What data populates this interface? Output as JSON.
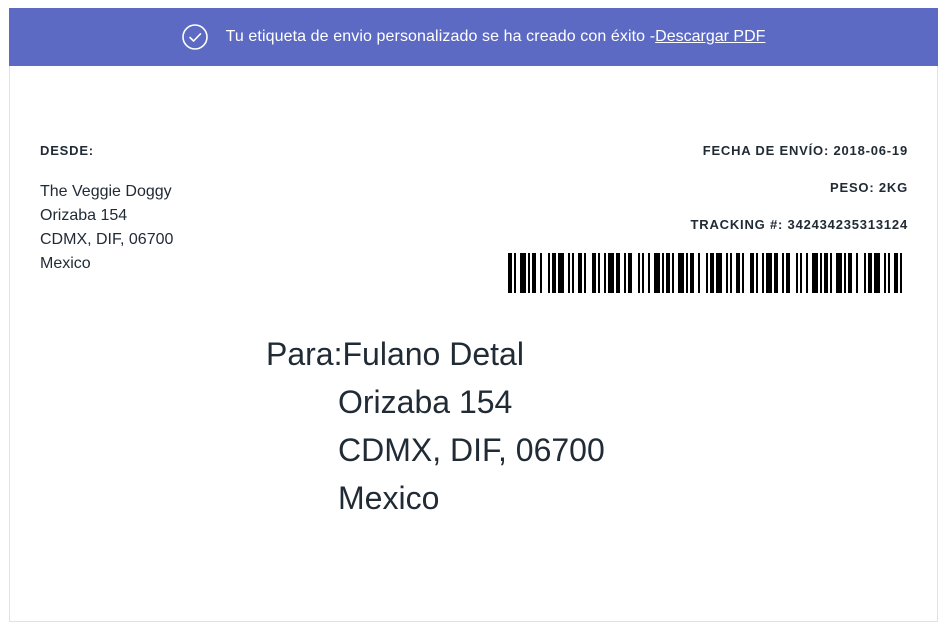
{
  "banner": {
    "message": "Tu etiqueta de envio personalizado se ha creado con éxito - ",
    "link_label": "Descargar PDF",
    "icon": "check-circle-icon",
    "color": "#5c6ac4"
  },
  "from": {
    "label": "DESDE:",
    "lines": [
      "The Veggie Doggy",
      "Orizaba 154",
      "CDMX, DIF, 06700",
      "Mexico"
    ]
  },
  "meta": {
    "ship_date": "FECHA DE ENVÍO: 2018-06-19",
    "weight": "PESO: 2KG",
    "tracking": "TRACKING #: 342434235313124"
  },
  "barcode": {
    "icon": "barcode-icon"
  },
  "to": {
    "prefix": "Para:",
    "name": "Fulano Detal",
    "lines": [
      "Orizaba 154",
      "CDMX, DIF, 06700",
      "Mexico"
    ]
  }
}
